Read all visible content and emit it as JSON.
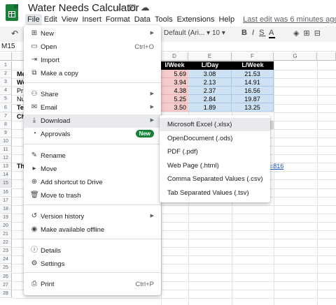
{
  "app": {
    "title": "Water Needs Calculator",
    "icons": [
      "star-icon",
      "move-folder-icon",
      "cloud-status-icon"
    ],
    "menus": [
      "File",
      "Edit",
      "View",
      "Insert",
      "Format",
      "Data",
      "Tools",
      "Extensions",
      "Help"
    ],
    "last_edit": "Last edit was 6 minutes ago"
  },
  "toolbar": {
    "font": "Default (Ari...",
    "size": "10",
    "bold": "B",
    "italic": "I",
    "strike": "S",
    "text_color": "A"
  },
  "namebox": "M15",
  "sheet": {
    "columns": [
      "D",
      "E",
      "F",
      "G"
    ],
    "rows": [
      "1",
      "2",
      "3",
      "4",
      "5",
      "6",
      "7",
      "8",
      "9",
      "10",
      "11",
      "12",
      "13",
      "14",
      "15",
      "16",
      "17",
      "18",
      "19",
      "20",
      "21",
      "22",
      "23",
      "24",
      "25",
      "26",
      "27",
      "28"
    ],
    "header_row": [
      "l/Week",
      "L/Day",
      "L/Week"
    ],
    "data": [
      [
        "5.69",
        "3.08",
        "21.53"
      ],
      [
        "3.94",
        "2.13",
        "14.91"
      ],
      [
        "4.38",
        "2.37",
        "16.56"
      ],
      [
        "5.25",
        "2.84",
        "19.87"
      ],
      [
        "3.50",
        "1.89",
        "13.25"
      ]
    ],
    "row_labels": [
      "Me",
      "We",
      "Pr",
      "Nu",
      "Te",
      "Ch"
    ],
    "link_row12_a": "Th",
    "link_row12_f": "=816"
  },
  "file_menu": {
    "items": [
      {
        "icon": "new-icon",
        "label": "New",
        "submenu": true
      },
      {
        "icon": "open-icon",
        "label": "Open",
        "shortcut": "Ctrl+O"
      },
      {
        "icon": "import-icon",
        "label": "Import"
      },
      {
        "icon": "copy-icon",
        "label": "Make a copy"
      },
      {
        "icon": "share-icon",
        "label": "Share",
        "submenu": true
      },
      {
        "icon": "email-icon",
        "label": "Email",
        "submenu": true
      },
      {
        "icon": "download-icon",
        "label": "Download",
        "submenu": true
      },
      {
        "icon": "approvals-icon",
        "label": "Approvals",
        "badge": "New"
      },
      {
        "icon": "rename-icon",
        "label": "Rename"
      },
      {
        "icon": "move-icon",
        "label": "Move"
      },
      {
        "icon": "shortcut-drive-icon",
        "label": "Add shortcut to Drive"
      },
      {
        "icon": "trash-icon",
        "label": "Move to trash"
      },
      {
        "icon": "history-icon",
        "label": "Version history",
        "submenu": true
      },
      {
        "icon": "offline-icon",
        "label": "Make available offline"
      },
      {
        "icon": "details-icon",
        "label": "Details"
      },
      {
        "icon": "settings-icon",
        "label": "Settings"
      },
      {
        "icon": "print-icon",
        "label": "Print",
        "shortcut": "Ctrl+P"
      }
    ]
  },
  "download_menu": {
    "items": [
      "Microsoft Excel (.xlsx)",
      "OpenDocument (.ods)",
      "PDF (.pdf)",
      "Web Page (.html)",
      "Comma Separated Values (.csv)",
      "Tab Separated Values (.tsv)"
    ]
  },
  "colors": {
    "brand": "#188038",
    "header_bg": "#000000",
    "pink": "#f4cccc",
    "blue": "#cfe2f3",
    "link": "#1155cc"
  }
}
